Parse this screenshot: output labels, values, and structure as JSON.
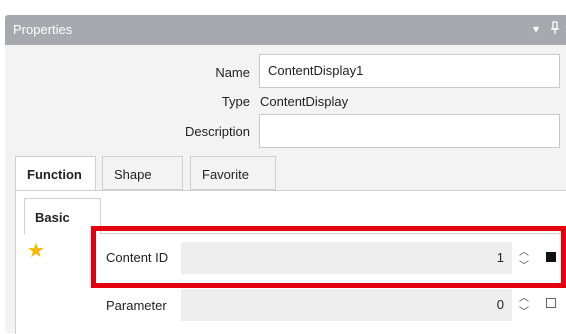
{
  "panel": {
    "title": "Properties",
    "controls": {
      "dropdown": "▾",
      "pin": "ꟷ",
      "close": "✕"
    }
  },
  "general": {
    "name_label": "Name",
    "name_value": "ContentDisplay1",
    "type_label": "Type",
    "type_value": "ContentDisplay",
    "description_label": "Description",
    "description_value": ""
  },
  "tabs": [
    {
      "label": "Function",
      "active": true
    },
    {
      "label": "Shape",
      "active": false
    },
    {
      "label": "Favorite",
      "active": false
    }
  ],
  "subtab": {
    "label": "Basic"
  },
  "favorite_icon": "star-icon",
  "properties": [
    {
      "label": "Content ID",
      "value": "1",
      "checked": true
    },
    {
      "label": "Parameter",
      "value": "0",
      "checked": false
    }
  ],
  "colors": {
    "title_bar": "#a7a9ae",
    "panel_bg": "#f3f3f3",
    "star": "#f5b800",
    "highlight": "#e3000f"
  }
}
